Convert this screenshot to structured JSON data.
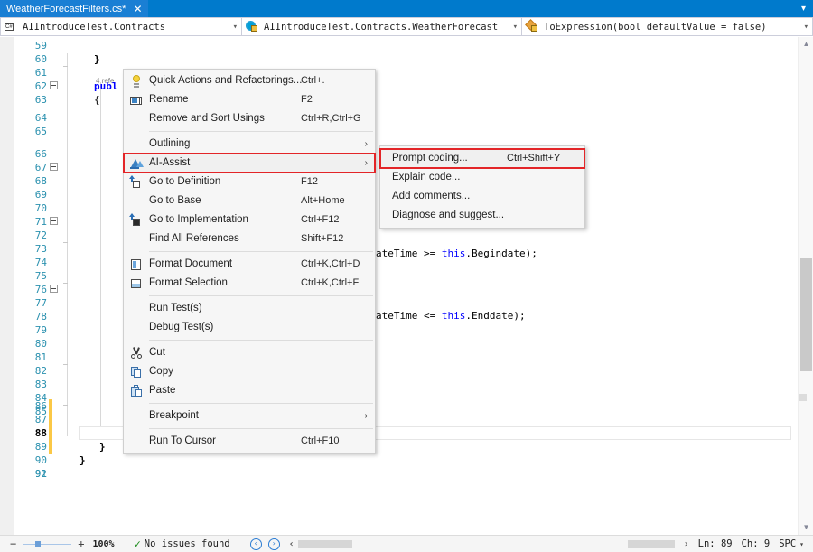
{
  "window": {
    "tab": {
      "title": "WeatherForecastFilters.cs*",
      "close_icon": "close-icon"
    },
    "tabstrip_overflow_icon": "chevron-down-icon"
  },
  "navbar": {
    "project_combo": {
      "icon": "csharp-file-icon",
      "value": "AIIntroduceTest.Contracts",
      "arrow": "chevron-down-icon"
    },
    "type_combo": {
      "icon": "class-icon",
      "value": "AIIntroduceTest.Contracts.WeatherForecast",
      "arrow": "chevron-down-icon"
    },
    "member_combo": {
      "icon": "method-icon",
      "value": "ToExpression(bool defaultValue = false)",
      "arrow": "chevron-down-icon"
    }
  },
  "editor": {
    "line_numbers": [
      "59",
      "60",
      "61",
      "62",
      "63",
      "64",
      "65",
      "66",
      "67",
      "68",
      "69",
      "70",
      "71",
      "72",
      "73",
      "74",
      "75",
      "76",
      "77",
      "78",
      "79",
      "80",
      "81",
      "82",
      "83",
      "84",
      "85",
      "86",
      "87",
      "88",
      "89",
      "90",
      "91",
      "92"
    ],
    "current_line": "89",
    "code_lines": [
      {
        "line": "60",
        "text": "}"
      },
      {
        "line": "61",
        "codelens": "4 refe"
      },
      {
        "line": "62",
        "text": "publ",
        "kind": "keyword"
      },
      {
        "line": "63",
        "text": "{"
      },
      {
        "line": "70",
        "text": "ateTime >= this.Begindate);"
      },
      {
        "line": "75",
        "text": "ateTime <= this.Enddate);"
      },
      {
        "line": "87",
        "text": "}"
      },
      {
        "line": "90",
        "text": "}"
      },
      {
        "line": "91",
        "text": "}"
      }
    ]
  },
  "context_menu": {
    "items": [
      {
        "label": "Quick Actions and Refactorings...",
        "shortcut": "Ctrl+.",
        "icon": "lightbulb-icon",
        "submenu": false
      },
      {
        "label": "Rename",
        "shortcut": "F2",
        "icon": "rename-icon",
        "submenu": false
      },
      {
        "label": "Remove and Sort Usings",
        "shortcut": "Ctrl+R,Ctrl+G",
        "icon": "",
        "submenu": false
      },
      {
        "separator": true
      },
      {
        "label": "Outlining",
        "shortcut": "",
        "icon": "",
        "submenu": true
      },
      {
        "label": "AI-Assist",
        "shortcut": "",
        "icon": "ai-assist-icon",
        "submenu": true,
        "highlighted": true
      },
      {
        "label": "Go to Definition",
        "shortcut": "F12",
        "icon": "go-to-definition-icon",
        "submenu": false
      },
      {
        "label": "Go to Base",
        "shortcut": "Alt+Home",
        "icon": "",
        "submenu": false
      },
      {
        "label": "Go to Implementation",
        "shortcut": "Ctrl+F12",
        "icon": "go-to-implementation-icon",
        "submenu": false
      },
      {
        "label": "Find All References",
        "shortcut": "Shift+F12",
        "icon": "",
        "submenu": false
      },
      {
        "separator": true
      },
      {
        "label": "Format Document",
        "shortcut": "Ctrl+K,Ctrl+D",
        "icon": "format-document-icon",
        "submenu": false
      },
      {
        "label": "Format Selection",
        "shortcut": "Ctrl+K,Ctrl+F",
        "icon": "format-selection-icon",
        "submenu": false
      },
      {
        "separator": true
      },
      {
        "label": "Run Test(s)",
        "shortcut": "",
        "icon": "",
        "submenu": false
      },
      {
        "label": "Debug Test(s)",
        "shortcut": "",
        "icon": "",
        "submenu": false
      },
      {
        "separator": true
      },
      {
        "label": "Cut",
        "shortcut": "",
        "icon": "cut-icon",
        "submenu": false
      },
      {
        "label": "Copy",
        "shortcut": "",
        "icon": "copy-icon",
        "submenu": false
      },
      {
        "label": "Paste",
        "shortcut": "",
        "icon": "paste-icon",
        "submenu": false
      },
      {
        "separator": true
      },
      {
        "label": "Breakpoint",
        "shortcut": "",
        "icon": "",
        "submenu": true
      },
      {
        "separator": true
      },
      {
        "label": "Run To Cursor",
        "shortcut": "Ctrl+F10",
        "icon": "",
        "submenu": false
      }
    ]
  },
  "submenu": {
    "items": [
      {
        "label": "Prompt coding...",
        "shortcut": "Ctrl+Shift+Y",
        "highlighted": true
      },
      {
        "label": "Explain code...",
        "shortcut": ""
      },
      {
        "label": "Add comments...",
        "shortcut": ""
      },
      {
        "label": "Diagnose and suggest...",
        "shortcut": ""
      }
    ]
  },
  "statusbar": {
    "zoom_minus": "−",
    "zoom_plus": "+",
    "zoom_level": "100%",
    "issues_check_icon": "checkmark-icon",
    "issues_text": "No issues found",
    "prev_icon": "‹",
    "next_icon": "›",
    "split_left_icon": "‹",
    "split_right_icon": "›",
    "line_label": "Ln: 89",
    "char_label": "Ch: 9",
    "spaces_label": "SPC",
    "spaces_arrow": "chevron-down-icon"
  },
  "scrollbar": {
    "up_arrow": "chevron-up-icon",
    "down_arrow": "chevron-down-icon"
  },
  "colors": {
    "accent": "#007acc",
    "highlight_border": "#e32528",
    "linenum": "#2b91af",
    "keyword": "#0000ff",
    "type": "#2b91af",
    "change_bar": "#fbc846"
  }
}
